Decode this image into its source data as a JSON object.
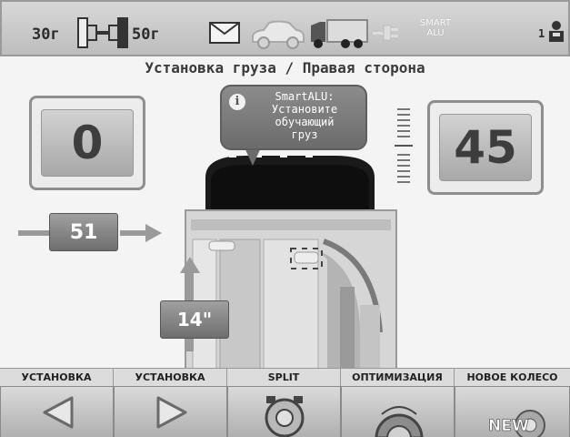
{
  "topbar": {
    "weight_min": "30г",
    "weight_max": "50г",
    "icons": [
      "wheel-balance-icon",
      "envelope-icon",
      "car-icon",
      "truck-icon",
      "plug-icon"
    ],
    "smart_alu_line1": "SMART",
    "smart_alu_line2": "ALU",
    "user_number": "1",
    "user_icon": "operator-icon"
  },
  "title": "Установка груза / Правая сторона",
  "left_value": "0",
  "right_value": "45",
  "callout": {
    "line1": "SmartALU:",
    "line2": "Установите",
    "line3": "обучающий",
    "line4": "груз",
    "icon": "info-icon"
  },
  "distance_value": "51",
  "diameter_value": "14\"",
  "buttons": [
    {
      "label": "УСТАНОВКА",
      "icon": "left-triangle-icon"
    },
    {
      "label": "УСТАНОВКА",
      "icon": "right-triangle-icon"
    },
    {
      "label": "SPLIT",
      "icon": "split-icon"
    },
    {
      "label": "ОПТИМИЗАЦИЯ",
      "icon": "optimization-icon"
    },
    {
      "label": "НОВОЕ КОЛЕСО",
      "icon": "new-wheel-icon",
      "icon_text": "NEW"
    }
  ],
  "colors": {
    "topbar_bg": "#c8c8c8",
    "panel_bg": "#f4f4f4",
    "callout_bg": "#7a7a7a"
  }
}
